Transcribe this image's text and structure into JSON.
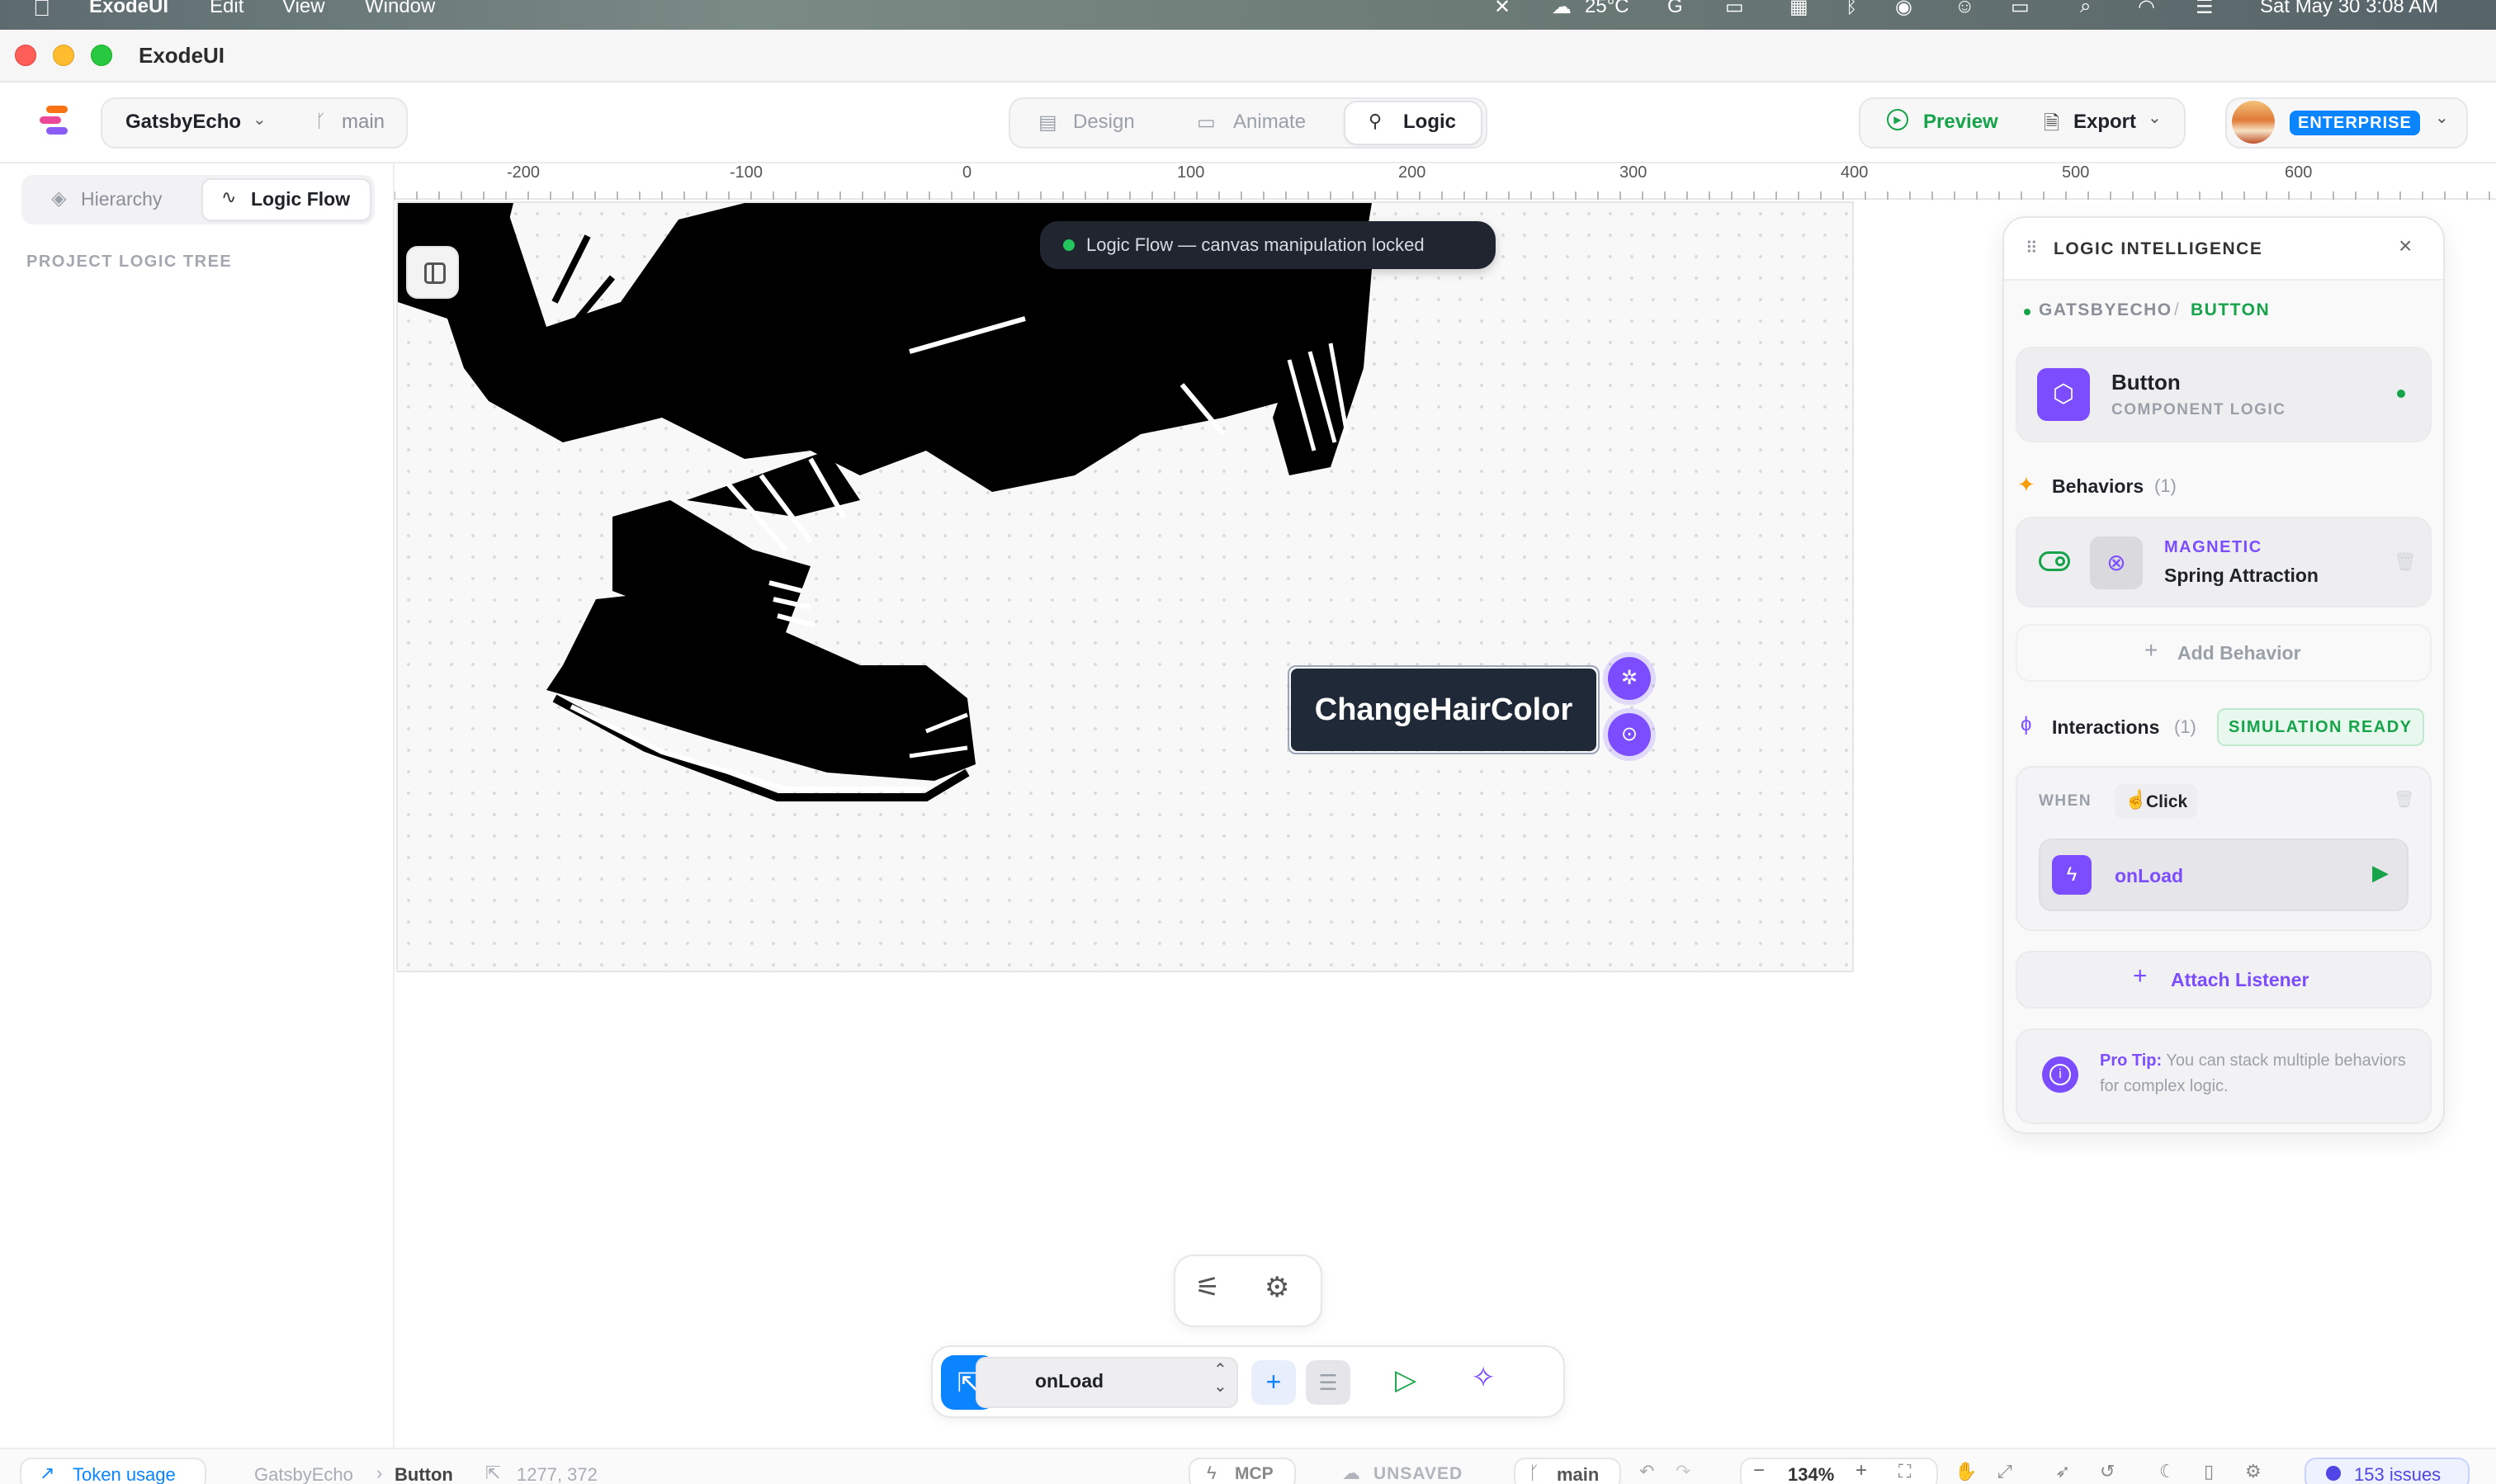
{
  "menubar": {
    "app": "ExodeUI",
    "items": [
      "Edit",
      "View",
      "Window"
    ],
    "temperature": "25°C",
    "datetime": "Sat May 30  3:08 AM"
  },
  "window": {
    "title": "ExodeUI"
  },
  "toolbar": {
    "project": "GatsbyEcho",
    "branch": "main",
    "modes": [
      "Design",
      "Animate",
      "Logic"
    ],
    "active_mode": "Logic",
    "preview_label": "Preview",
    "export_label": "Export",
    "plan_badge": "ENTERPRISE"
  },
  "sidebar": {
    "tabs": [
      "Hierarchy",
      "Logic Flow"
    ],
    "active_tab": "Logic Flow",
    "section_title": "PROJECT LOGIC TREE"
  },
  "ruler": {
    "ticks": [
      "-200",
      "-100",
      "0",
      "100",
      "200",
      "300",
      "400",
      "500",
      "600"
    ]
  },
  "canvas": {
    "banner": "Logic Flow — canvas manipulation locked",
    "selected_button_label": "ChangeHairColor"
  },
  "panel": {
    "title": "LOGIC INTELLIGENCE",
    "breadcrumb_project": "GATSBYECHO",
    "breadcrumb_sep": "/",
    "breadcrumb_component": "BUTTON",
    "component_name": "Button",
    "component_kind": "COMPONENT LOGIC",
    "behaviors_label": "Behaviors",
    "behaviors_count": "(1)",
    "behavior_type": "MAGNETIC",
    "behavior_name": "Spring Attraction",
    "add_behavior": "Add Behavior",
    "interactions_label": "Interactions",
    "interactions_count": "(1)",
    "simulation_badge": "SIMULATION READY",
    "when_label": "WHEN",
    "trigger": "Click",
    "action": "onLoad",
    "attach_listener": "Attach Listener",
    "protip_label": "Pro Tip:",
    "protip_text": "You can stack multiple behaviors for complex logic.",
    "colors": {
      "accent_purple": "#7c4dff",
      "accent_green": "#16a34a",
      "primary_blue": "#0a84ff"
    }
  },
  "bottom_toolbar": {
    "event_select": "onLoad"
  },
  "statusbar": {
    "token_usage": "Token usage",
    "crumb_project": "GatsbyEcho",
    "crumb_component": "Button",
    "coords": "1277, 372",
    "mcp": "MCP",
    "unsaved": "UNSAVED",
    "branch": "main",
    "zoom": "134%",
    "issues": "153 issues"
  }
}
